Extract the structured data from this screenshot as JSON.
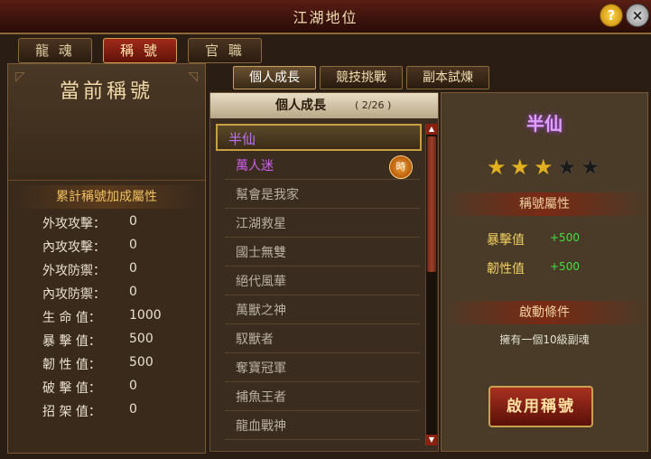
{
  "window": {
    "title": "江湖地位"
  },
  "header": {
    "help_label": "?",
    "close_label": "×"
  },
  "top_tabs": [
    {
      "label": "龍 魂",
      "active": false
    },
    {
      "label": "稱 號",
      "active": true
    },
    {
      "label": "官 職",
      "active": false
    }
  ],
  "left": {
    "current_title_label": "當前稱號",
    "attr_header": "累計稱號加成屬性",
    "attrs": [
      {
        "label": "外攻攻擊：",
        "value": "0"
      },
      {
        "label": "內攻攻擊：",
        "value": "0"
      },
      {
        "label": "外攻防禦：",
        "value": "0"
      },
      {
        "label": "內攻防禦：",
        "value": "0"
      },
      {
        "label": "生 命 值：",
        "value": "1000"
      },
      {
        "label": "暴 擊 值：",
        "value": "500"
      },
      {
        "label": "韌 性 值：",
        "value": "500"
      },
      {
        "label": "破 擊 值：",
        "value": "0"
      },
      {
        "label": "招 架 值：",
        "value": "0"
      }
    ]
  },
  "sub_tabs": [
    {
      "label": "個人成長",
      "active": true
    },
    {
      "label": "競技挑戰",
      "active": false
    },
    {
      "label": "副本試煉",
      "active": false
    }
  ],
  "list": {
    "header": "個人成長",
    "count": "( 2/26 )",
    "items": [
      {
        "label": "半仙",
        "selected": true
      },
      {
        "label": "萬人迷",
        "badge": "時"
      },
      {
        "label": "幫會是我家"
      },
      {
        "label": "江湖救星"
      },
      {
        "label": "國士無雙"
      },
      {
        "label": "絕代風華"
      },
      {
        "label": "萬獸之神"
      },
      {
        "label": "馭獸者"
      },
      {
        "label": "奪寶冠軍"
      },
      {
        "label": "捕魚王者"
      },
      {
        "label": "龍血戰神"
      }
    ]
  },
  "detail": {
    "name": "半仙",
    "stars_filled": 3,
    "stars_total": 5,
    "props_header": "稱號屬性",
    "props": [
      {
        "label": "暴擊值",
        "value": "+500"
      },
      {
        "label": "韌性值",
        "value": "+500"
      }
    ],
    "cond_header": "啟動條件",
    "condition": "擁有一個10級副魂",
    "activate_label": "啟用稱號"
  },
  "colors": {
    "accent": "#a02a1a",
    "gold": "#f0c060",
    "bonus": "#40e040",
    "purple": "#c070ff"
  }
}
